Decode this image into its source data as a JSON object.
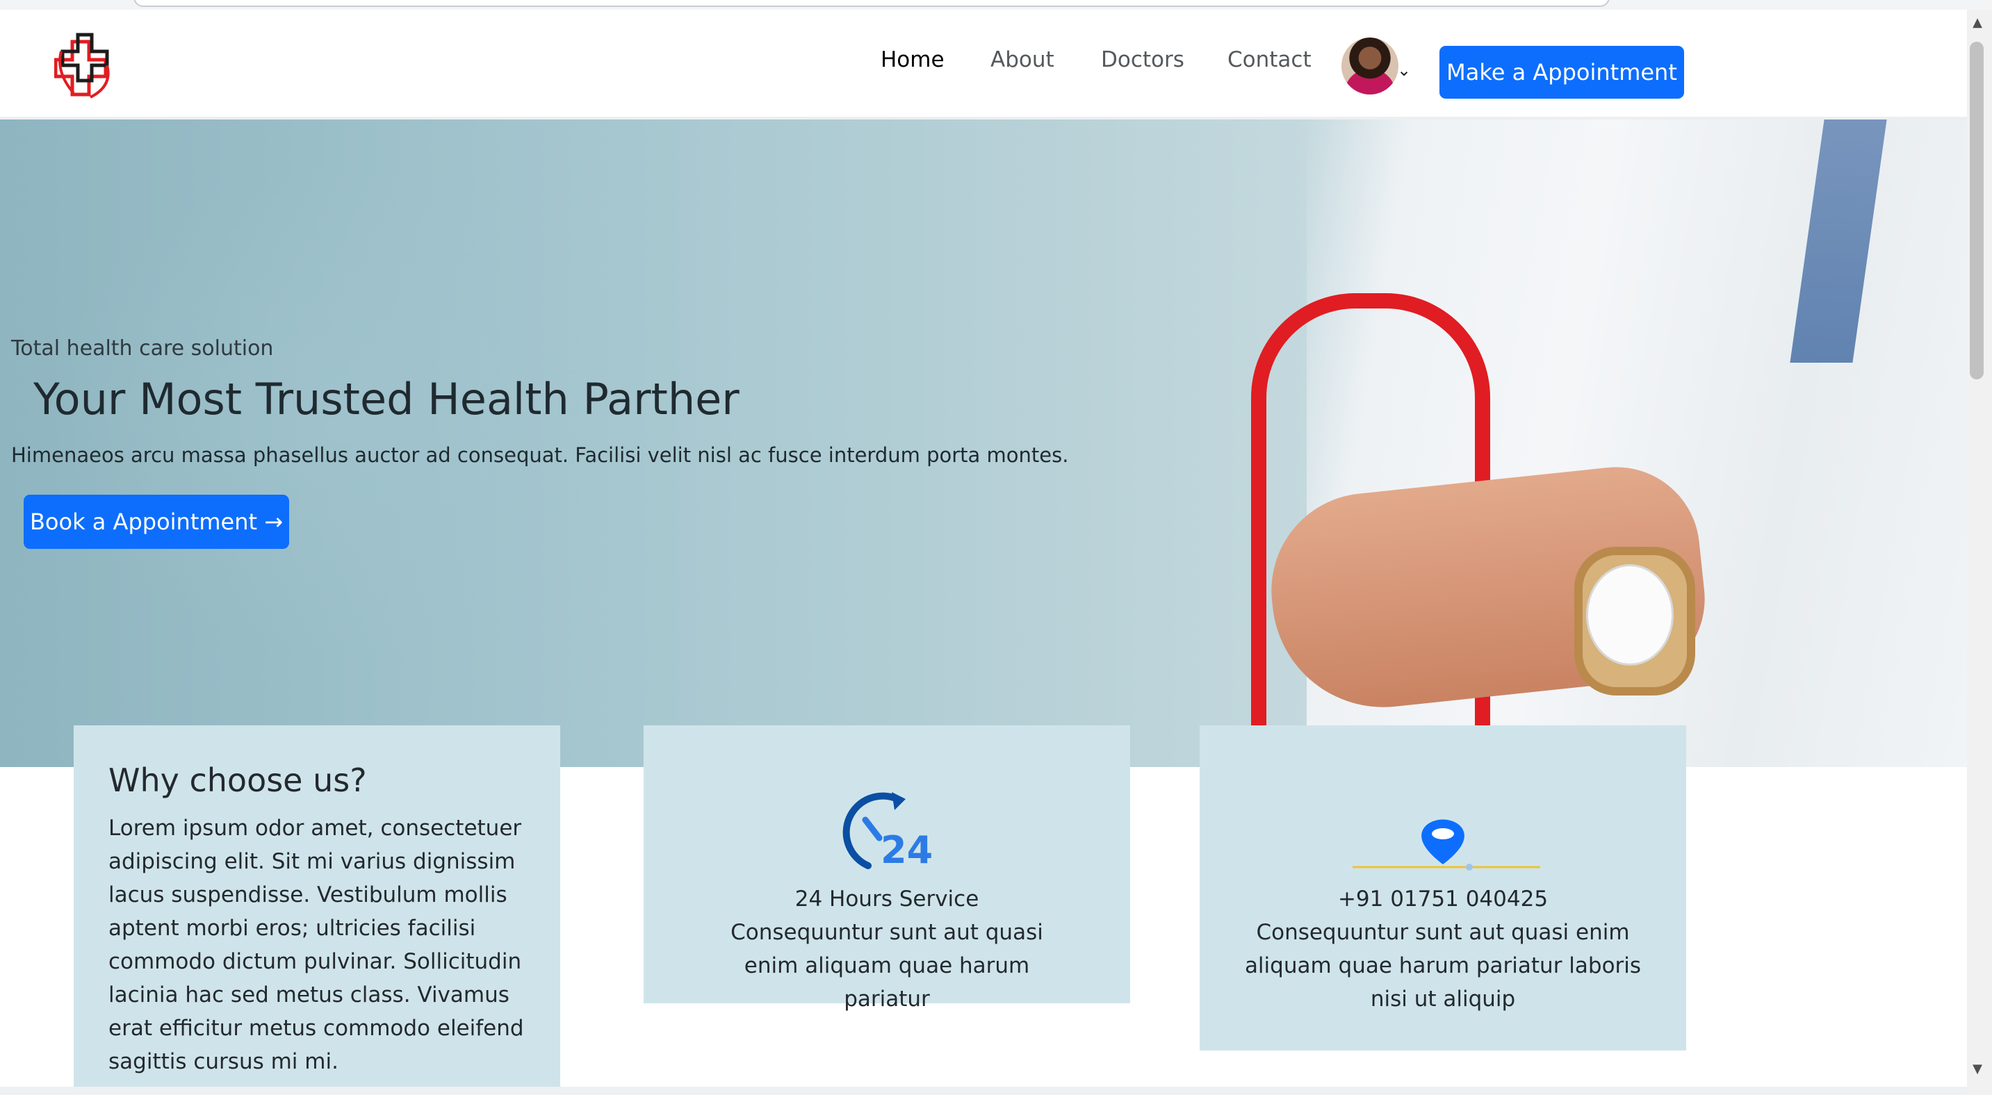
{
  "nav": {
    "links": [
      "Home",
      "About",
      "Doctors",
      "Contact"
    ],
    "cta": "Make a Appointment"
  },
  "hero": {
    "subtitle": "Total health care solution",
    "title": "Your Most Trusted Health Parther",
    "description": "Himenaeos arcu massa phasellus auctor ad consequat. Facilisi velit nisl ac fusce interdum porta montes.",
    "cta": "Book a Appointment →"
  },
  "cards": {
    "why": {
      "title": "Why choose us?",
      "text": "Lorem ipsum odor amet, consectetuer adipiscing elit. Sit mi varius dignissim lacus suspendisse. Vestibulum mollis aptent morbi eros; ultricies facilisi commodo dictum pulvinar. Sollicitudin lacinia hac sed metus class. Vivamus erat efficitur metus commodo eleifend sagittis cursus mi mi."
    },
    "service": {
      "icon": "24-hours-icon",
      "title": "24 Hours Service",
      "text": "Consequuntur sunt aut quasi enim aliquam quae harum pariatur"
    },
    "phone": {
      "icon": "location-pin-icon",
      "title": "+91 01751 040425",
      "text": "Consequuntur sunt aut quasi enim aliquam quae harum pariatur laboris nisi ut aliquip"
    }
  },
  "colors": {
    "primary": "#0d6efd",
    "card_bg": "#cfe4ea",
    "logo_red": "#e01d22"
  }
}
